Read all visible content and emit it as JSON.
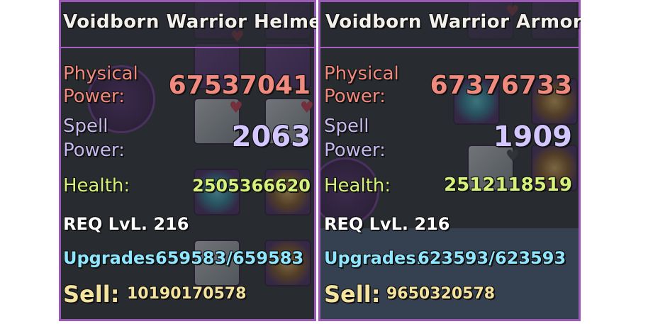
{
  "panels": [
    {
      "title": "Voidborn Warrior Helmet",
      "physical_label_1": "Physical",
      "physical_label_2": "Power:",
      "physical_value": "67537041",
      "spell_label_1": "Spell",
      "spell_label_2": "Power:",
      "spell_value": "2063",
      "health_label": "Health:",
      "health_value": "2505366620",
      "req": "REQ LvL. 216",
      "upgrades_label": "Upgrades:",
      "upgrades_value": "659583/659583",
      "sell_label": "Sell:",
      "sell_value": "10190170578"
    },
    {
      "title": "Voidborn Warrior Armor",
      "physical_label_1": "Physical",
      "physical_label_2": "Power:",
      "physical_value": "67376733",
      "spell_label_1": "Spell",
      "spell_label_2": "Power:",
      "spell_value": "1909",
      "health_label": "Health:",
      "health_value": "2512118519",
      "req": "REQ LvL. 216",
      "upgrades_label": "Upgrades:",
      "upgrades_value": "623593/623593",
      "sell_label": "Sell:",
      "sell_value": "9650320578"
    }
  ],
  "colors": {
    "frame": "#9b58b4",
    "physical": "#f08a7e",
    "spell": "#c7b8ee",
    "health": "#d6f27a",
    "upgrades": "#8fe6ff",
    "sell": "#f4e4a0"
  },
  "icons": [
    "heart-icon",
    "ring-icon",
    "crystal-icon",
    "spiked-orb-icon"
  ]
}
